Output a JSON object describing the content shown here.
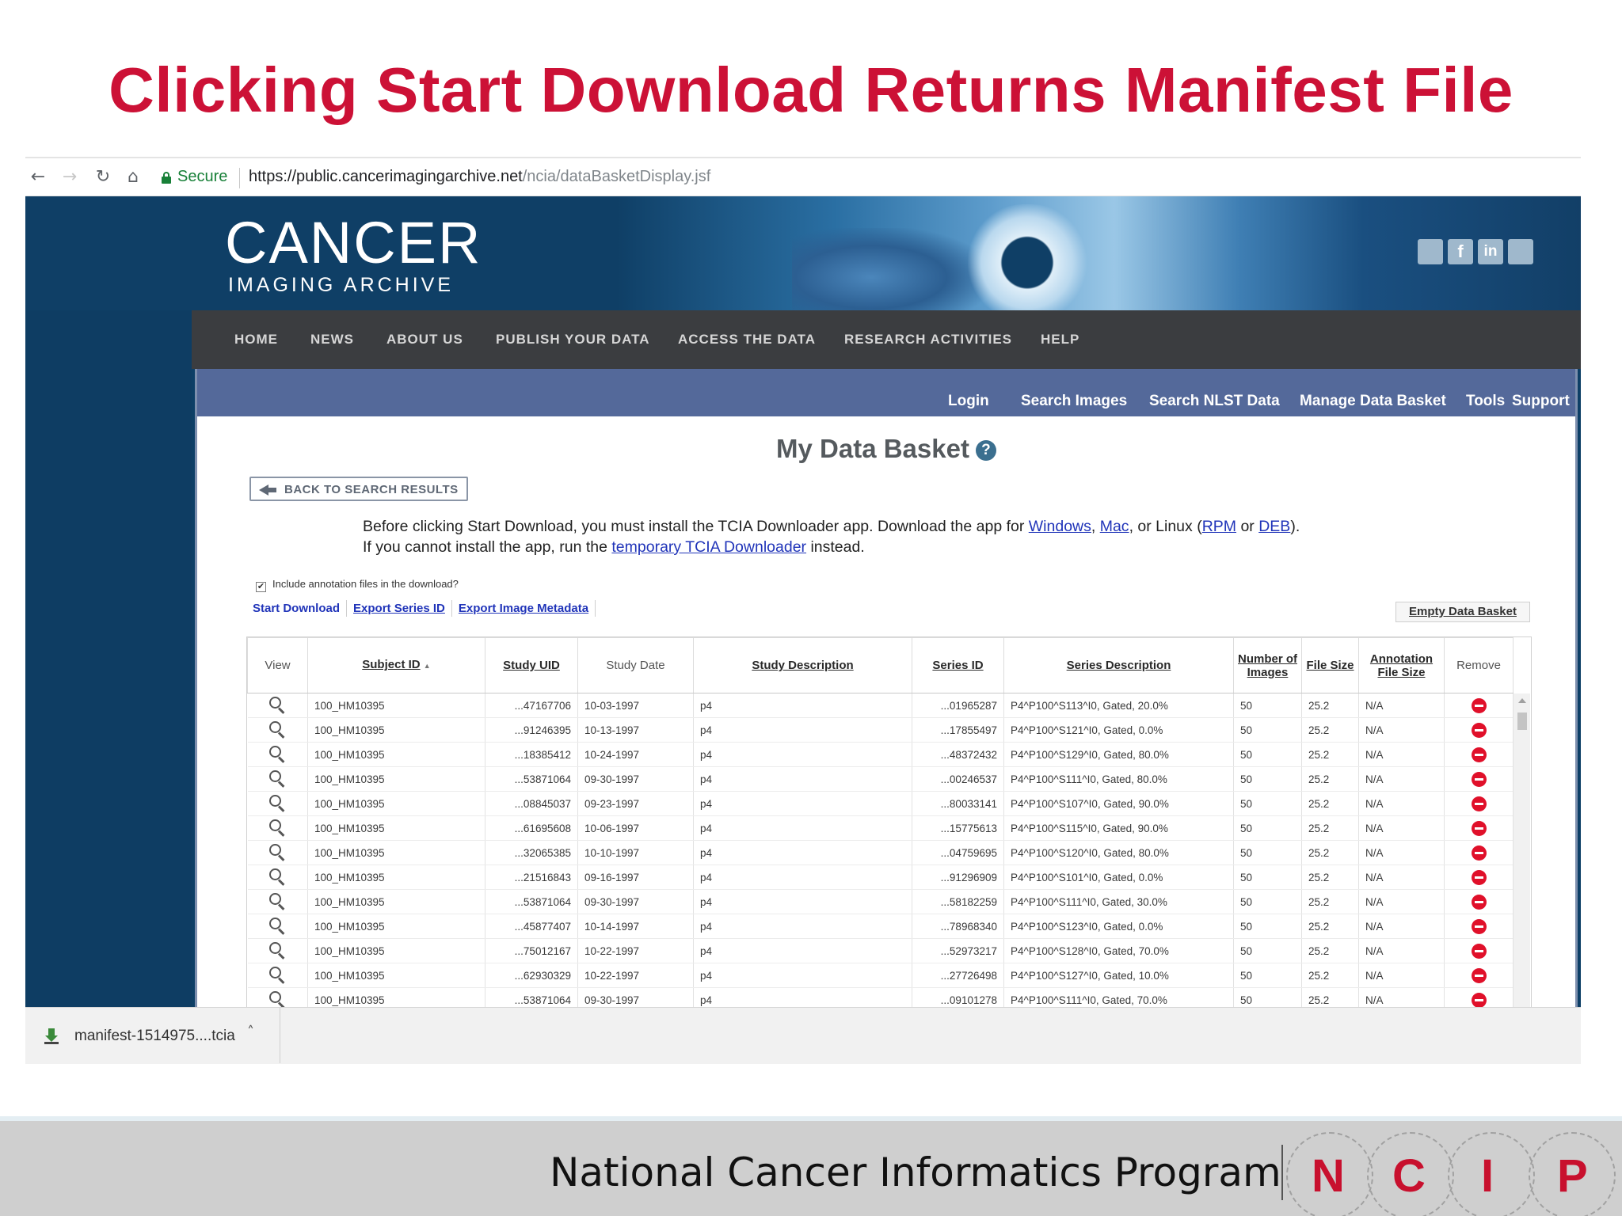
{
  "slide": {
    "title": "Clicking Start Download Returns Manifest File",
    "footer_text": "National Cancer Informatics Program",
    "logo_letters": [
      "N",
      "C",
      "I",
      "P"
    ],
    "accent_color": "#cc1136"
  },
  "browser": {
    "back_icon": "←",
    "forward_icon": "→",
    "reload_icon": "↻",
    "home_icon": "⌂",
    "secure_label": "Secure",
    "url_main": "https://public.cancerimagingarchive.net",
    "url_path": "/ncia/dataBasketDisplay.jsf"
  },
  "site": {
    "logo_main": "CANCER",
    "logo_sub": "IMAGING ARCHIVE",
    "social": [
      "f",
      "in"
    ],
    "top_nav": [
      "HOME",
      "NEWS",
      "ABOUT US",
      "PUBLISH YOUR DATA",
      "ACCESS THE DATA",
      "RESEARCH ACTIVITIES",
      "HELP"
    ],
    "sub_nav": [
      "Login",
      "Search Images",
      "Search NLST Data",
      "Manage Data Basket",
      "Tools",
      "Support"
    ]
  },
  "basket": {
    "title": "My Data Basket",
    "help_icon": "?",
    "back_button": "BACK TO SEARCH RESULTS",
    "instructions_line1_pre": "Before clicking Start Download, you must install the TCIA Downloader app. Download the app for ",
    "link_windows": "Windows",
    "sep_comma": ", ",
    "link_mac": "Mac",
    "instructions_line1_mid": ", or Linux (",
    "link_rpm": "RPM",
    "word_or": " or ",
    "link_deb": "DEB",
    "instructions_line1_end": ").",
    "instructions_line2_pre": "If you cannot install the app, run the ",
    "link_temp": "temporary TCIA Downloader",
    "instructions_line2_end": " instead.",
    "annotation_checkbox_label": "Include annotation files in the download?",
    "annotation_checked": true,
    "check_mark": "✔",
    "actions": [
      "Start Download",
      "Export Series ID",
      "Export Image Metadata"
    ],
    "empty_button": "Empty Data Basket"
  },
  "table": {
    "headers": {
      "view": "View",
      "subject_id": "Subject ID",
      "sort_indicator": "▲",
      "study_uid": "Study UID",
      "study_date": "Study Date",
      "study_description": "Study Description",
      "series_id": "Series ID",
      "series_description": "Series Description",
      "num_images": "Number of Images",
      "file_size": "File Size",
      "annotation_size": "Annotation File Size",
      "remove": "Remove"
    },
    "rows": [
      {
        "subject": "100_HM10395",
        "uid": "...47167706",
        "date": "10-03-1997",
        "desc": "p4",
        "series": "...01965287",
        "sdesc": "P4^P100^S113^I0, Gated, 20.0%",
        "n": "50",
        "size": "25.2",
        "annot": "N/A"
      },
      {
        "subject": "100_HM10395",
        "uid": "...91246395",
        "date": "10-13-1997",
        "desc": "p4",
        "series": "...17855497",
        "sdesc": "P4^P100^S121^I0, Gated, 0.0%",
        "n": "50",
        "size": "25.2",
        "annot": "N/A"
      },
      {
        "subject": "100_HM10395",
        "uid": "...18385412",
        "date": "10-24-1997",
        "desc": "p4",
        "series": "...48372432",
        "sdesc": "P4^P100^S129^I0, Gated, 80.0%",
        "n": "50",
        "size": "25.2",
        "annot": "N/A"
      },
      {
        "subject": "100_HM10395",
        "uid": "...53871064",
        "date": "09-30-1997",
        "desc": "p4",
        "series": "...00246537",
        "sdesc": "P4^P100^S111^I0, Gated, 80.0%",
        "n": "50",
        "size": "25.2",
        "annot": "N/A"
      },
      {
        "subject": "100_HM10395",
        "uid": "...08845037",
        "date": "09-23-1997",
        "desc": "p4",
        "series": "...80033141",
        "sdesc": "P4^P100^S107^I0, Gated, 90.0%",
        "n": "50",
        "size": "25.2",
        "annot": "N/A"
      },
      {
        "subject": "100_HM10395",
        "uid": "...61695608",
        "date": "10-06-1997",
        "desc": "p4",
        "series": "...15775613",
        "sdesc": "P4^P100^S115^I0, Gated, 90.0%",
        "n": "50",
        "size": "25.2",
        "annot": "N/A"
      },
      {
        "subject": "100_HM10395",
        "uid": "...32065385",
        "date": "10-10-1997",
        "desc": "p4",
        "series": "...04759695",
        "sdesc": "P4^P100^S120^I0, Gated, 80.0%",
        "n": "50",
        "size": "25.2",
        "annot": "N/A"
      },
      {
        "subject": "100_HM10395",
        "uid": "...21516843",
        "date": "09-16-1997",
        "desc": "p4",
        "series": "...91296909",
        "sdesc": "P4^P100^S101^I0, Gated, 0.0%",
        "n": "50",
        "size": "25.2",
        "annot": "N/A"
      },
      {
        "subject": "100_HM10395",
        "uid": "...53871064",
        "date": "09-30-1997",
        "desc": "p4",
        "series": "...58182259",
        "sdesc": "P4^P100^S111^I0, Gated, 30.0%",
        "n": "50",
        "size": "25.2",
        "annot": "N/A"
      },
      {
        "subject": "100_HM10395",
        "uid": "...45877407",
        "date": "10-14-1997",
        "desc": "p4",
        "series": "...78968340",
        "sdesc": "P4^P100^S123^I0, Gated, 0.0%",
        "n": "50",
        "size": "25.2",
        "annot": "N/A"
      },
      {
        "subject": "100_HM10395",
        "uid": "...75012167",
        "date": "10-22-1997",
        "desc": "p4",
        "series": "...52973217",
        "sdesc": "P4^P100^S128^I0, Gated, 70.0%",
        "n": "50",
        "size": "25.2",
        "annot": "N/A"
      },
      {
        "subject": "100_HM10395",
        "uid": "...62930329",
        "date": "10-22-1997",
        "desc": "p4",
        "series": "...27726498",
        "sdesc": "P4^P100^S127^I0, Gated, 10.0%",
        "n": "50",
        "size": "25.2",
        "annot": "N/A"
      },
      {
        "subject": "100_HM10395",
        "uid": "...53871064",
        "date": "09-30-1997",
        "desc": "p4",
        "series": "...09101278",
        "sdesc": "P4^P100^S111^I0, Gated, 70.0%",
        "n": "50",
        "size": "25.2",
        "annot": "N/A"
      }
    ]
  },
  "download_bar": {
    "filename": "manifest-1514975....tcia",
    "chevron": "˄"
  }
}
